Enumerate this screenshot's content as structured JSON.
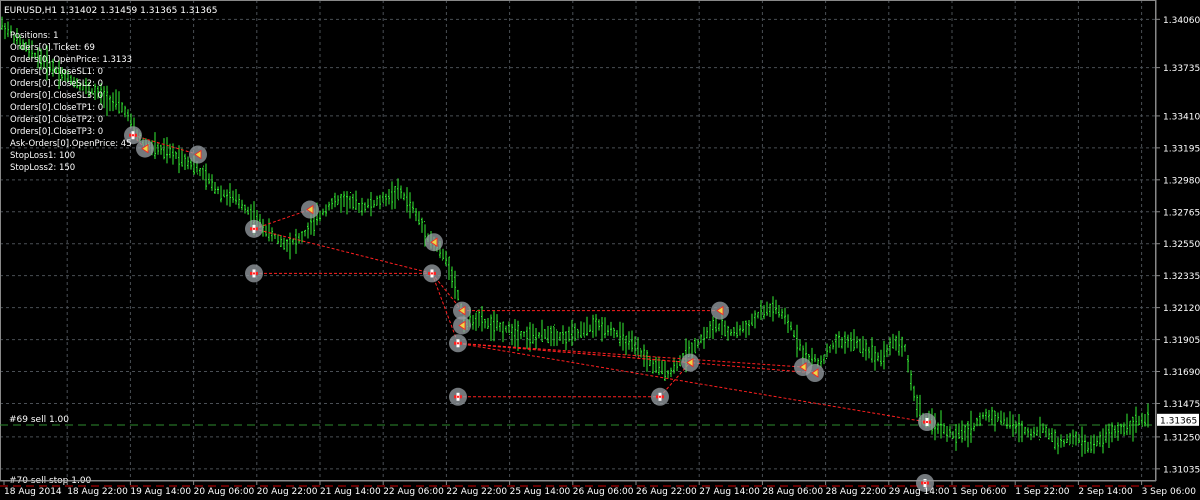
{
  "window": {
    "title": "EURUSD,H1  1.31402 1.31459 1.31365 1.31365",
    "current_price": "1.31365"
  },
  "info_panel": {
    "lines": [
      "Positions: 1",
      "Orders[0].Ticket: 69",
      "Orders[0].OpenPrice: 1.3133",
      "Orders[0].CloseSL1: 0",
      "Orders[0].CloseSL2: 0",
      "Orders[0].CloseSL3: 0",
      "Orders[0].CloseTP1: 0",
      "Orders[0].CloseTP2: 0",
      "Orders[0].CloseTP3: 0",
      "Ask-Orders[0].OpenPrice: 45",
      "StopLoss1: 100",
      "StopLoss2: 150"
    ]
  },
  "order_lines": [
    {
      "label": "#69 sell 1.00",
      "price": 1.3133,
      "color": "#2e8b2e"
    },
    {
      "label": "#70 sell stop 1.00",
      "price": 1.3092,
      "color": "#cc0000"
    }
  ],
  "colors": {
    "background": "#000000",
    "grid": "#4a4f55",
    "candle": "#33ee33",
    "trade_line": "#ff2020",
    "marker_halo": "#9aa0a6",
    "axis_text": "#ffffff"
  },
  "chart_data": {
    "type": "line",
    "title": "EURUSD,H1  1.31402 1.31459 1.31365 1.31365",
    "symbol": "EURUSD",
    "timeframe": "H1",
    "ohlc_last": {
      "open": 1.31402,
      "high": 1.31459,
      "low": 1.31365,
      "close": 1.31365
    },
    "ylim": [
      1.3096,
      1.3419
    ],
    "y_ticks": [
      "1.34060",
      "1.33735",
      "1.33410",
      "1.33195",
      "1.32980",
      "1.32765",
      "1.32550",
      "1.32335",
      "1.32120",
      "1.31905",
      "1.31690",
      "1.31475",
      "1.31250",
      "1.31035"
    ],
    "x_ticks": [
      "18 Aug 2014",
      "18 Aug 22:00",
      "19 Aug 14:00",
      "20 Aug 06:00",
      "20 Aug 22:00",
      "21 Aug 14:00",
      "22 Aug 06:00",
      "22 Aug 22:00",
      "25 Aug 14:00",
      "26 Aug 06:00",
      "26 Aug 22:00",
      "27 Aug 14:00",
      "28 Aug 06:00",
      "28 Aug 22:00",
      "29 Aug 14:00",
      "1 Sep 06:00",
      "1 Sep 22:00",
      "2 Sep 14:00",
      "3 Sep 06:00"
    ],
    "price_series": [
      [
        0,
        1.3403
      ],
      [
        10,
        1.3398
      ],
      [
        20,
        1.339
      ],
      [
        35,
        1.3382
      ],
      [
        50,
        1.3375
      ],
      [
        65,
        1.3368
      ],
      [
        80,
        1.3362
      ],
      [
        95,
        1.3357
      ],
      [
        110,
        1.3352
      ],
      [
        125,
        1.3345
      ],
      [
        135,
        1.333
      ],
      [
        145,
        1.3322
      ],
      [
        160,
        1.3318
      ],
      [
        175,
        1.3315
      ],
      [
        190,
        1.331
      ],
      [
        205,
        1.33
      ],
      [
        220,
        1.329
      ],
      [
        240,
        1.3283
      ],
      [
        255,
        1.3272
      ],
      [
        270,
        1.3262
      ],
      [
        285,
        1.3255
      ],
      [
        300,
        1.3258
      ],
      [
        315,
        1.327
      ],
      [
        330,
        1.3282
      ],
      [
        345,
        1.3285
      ],
      [
        360,
        1.328
      ],
      [
        375,
        1.3282
      ],
      [
        390,
        1.3287
      ],
      [
        400,
        1.329
      ],
      [
        410,
        1.3282
      ],
      [
        420,
        1.327
      ],
      [
        430,
        1.3258
      ],
      [
        440,
        1.325
      ],
      [
        450,
        1.324
      ],
      [
        458,
        1.322
      ],
      [
        465,
        1.32
      ],
      [
        475,
        1.3205
      ],
      [
        490,
        1.32
      ],
      [
        505,
        1.3198
      ],
      [
        520,
        1.3195
      ],
      [
        535,
        1.3192
      ],
      [
        550,
        1.3195
      ],
      [
        565,
        1.3192
      ],
      [
        580,
        1.3195
      ],
      [
        595,
        1.32
      ],
      [
        610,
        1.3198
      ],
      [
        625,
        1.319
      ],
      [
        640,
        1.3182
      ],
      [
        655,
        1.3172
      ],
      [
        670,
        1.3168
      ],
      [
        685,
        1.318
      ],
      [
        700,
        1.319
      ],
      [
        715,
        1.32
      ],
      [
        730,
        1.3195
      ],
      [
        745,
        1.3198
      ],
      [
        760,
        1.3208
      ],
      [
        775,
        1.3212
      ],
      [
        790,
        1.32
      ],
      [
        805,
        1.318
      ],
      [
        820,
        1.3175
      ],
      [
        835,
        1.3188
      ],
      [
        850,
        1.319
      ],
      [
        865,
        1.3185
      ],
      [
        880,
        1.3178
      ],
      [
        895,
        1.319
      ],
      [
        905,
        1.3185
      ],
      [
        915,
        1.315
      ],
      [
        925,
        1.3135
      ],
      [
        940,
        1.3132
      ],
      [
        955,
        1.3125
      ],
      [
        970,
        1.313
      ],
      [
        985,
        1.314
      ],
      [
        1000,
        1.3138
      ],
      [
        1015,
        1.3132
      ],
      [
        1030,
        1.3128
      ],
      [
        1045,
        1.313
      ],
      [
        1060,
        1.312
      ],
      [
        1075,
        1.3125
      ],
      [
        1090,
        1.3118
      ],
      [
        1105,
        1.3125
      ],
      [
        1120,
        1.313
      ],
      [
        1135,
        1.3135
      ],
      [
        1150,
        1.3137
      ]
    ]
  },
  "trades": [
    {
      "open": [
        133,
        1.3328
      ],
      "close": [
        198,
        1.3315
      ],
      "type": "sell"
    },
    {
      "open": [
        133,
        1.3328
      ],
      "close": [
        145,
        1.3319
      ],
      "type": "sell"
    },
    {
      "open": [
        254,
        1.3265
      ],
      "close": [
        310,
        1.3278
      ],
      "type": "buy"
    },
    {
      "open": [
        254,
        1.3265
      ],
      "close": [
        432,
        1.3235
      ],
      "type": "sell"
    },
    {
      "open": [
        254,
        1.3235
      ],
      "close": [
        432,
        1.3235
      ],
      "type": "sell"
    },
    {
      "open": [
        432,
        1.3235
      ],
      "close": [
        462,
        1.321
      ],
      "type": "sell"
    },
    {
      "open": [
        432,
        1.3235
      ],
      "close": [
        458,
        1.3188
      ],
      "type": "sell"
    },
    {
      "open": [
        458,
        1.3188
      ],
      "close": [
        690,
        1.3175
      ],
      "type": "sell"
    },
    {
      "open": [
        458,
        1.3188
      ],
      "close": [
        803,
        1.3172
      ],
      "type": "sell"
    },
    {
      "open": [
        458,
        1.3188
      ],
      "close": [
        815,
        1.3168
      ],
      "type": "sell"
    },
    {
      "open": [
        458,
        1.3188
      ],
      "close": [
        927,
        1.3135
      ],
      "type": "sell"
    },
    {
      "open": [
        458,
        1.3152
      ],
      "close": [
        660,
        1.3152
      ],
      "type": "sell"
    },
    {
      "open": [
        462,
        1.321
      ],
      "close": [
        720,
        1.321
      ],
      "type": "buy"
    },
    {
      "open": [
        660,
        1.3152
      ],
      "close": [
        690,
        1.3175
      ],
      "type": "buy"
    }
  ],
  "markers": [
    {
      "x": 133,
      "y": 1.3328,
      "kind": "open"
    },
    {
      "x": 145,
      "y": 1.3319,
      "kind": "close"
    },
    {
      "x": 198,
      "y": 1.3315,
      "kind": "close"
    },
    {
      "x": 254,
      "y": 1.3265,
      "kind": "open"
    },
    {
      "x": 310,
      "y": 1.3278,
      "kind": "close"
    },
    {
      "x": 254,
      "y": 1.3235,
      "kind": "open"
    },
    {
      "x": 432,
      "y": 1.3235,
      "kind": "open"
    },
    {
      "x": 434,
      "y": 1.3256,
      "kind": "close"
    },
    {
      "x": 462,
      "y": 1.321,
      "kind": "close"
    },
    {
      "x": 462,
      "y": 1.32,
      "kind": "close"
    },
    {
      "x": 458,
      "y": 1.3188,
      "kind": "open"
    },
    {
      "x": 458,
      "y": 1.3152,
      "kind": "open"
    },
    {
      "x": 660,
      "y": 1.3152,
      "kind": "open"
    },
    {
      "x": 690,
      "y": 1.3175,
      "kind": "close"
    },
    {
      "x": 720,
      "y": 1.321,
      "kind": "close"
    },
    {
      "x": 803,
      "y": 1.3172,
      "kind": "close"
    },
    {
      "x": 815,
      "y": 1.3168,
      "kind": "close"
    },
    {
      "x": 927,
      "y": 1.3135,
      "kind": "open"
    },
    {
      "x": 925,
      "y": 1.3094,
      "kind": "open"
    }
  ]
}
